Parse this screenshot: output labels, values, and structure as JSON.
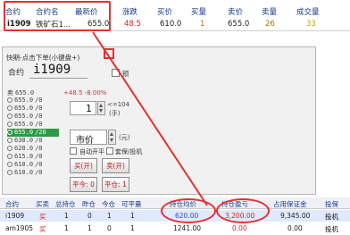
{
  "quote_table": {
    "headers": [
      "合约",
      "合约名",
      "最新价",
      "涨跌",
      "买价",
      "买量",
      "卖价",
      "卖量",
      "成交量"
    ],
    "row": {
      "code": "i1909",
      "name": "铁矿石1...",
      "last": "655.0",
      "change": "48.5",
      "bid": "610.0",
      "bid_vol": "1",
      "ask": "655.0",
      "ask_vol": "26",
      "volume": "33"
    }
  },
  "order_panel": {
    "title": "快期-点击下单(小键盘+)",
    "contract_label": "合约",
    "contract_code": "i1909",
    "pin_label": "锁",
    "price_range": "+48.5 -8.00%",
    "depth": [
      {
        "label": "卖",
        "price": "655.0",
        "qty": ""
      },
      {
        "label": "",
        "price": "655.0",
        "qty": "/0"
      },
      {
        "label": "",
        "price": "655.0",
        "qty": "/0"
      },
      {
        "label": "",
        "price": "655.0",
        "qty": "/0"
      },
      {
        "label": "",
        "price": "655.0",
        "qty": "/0"
      },
      {
        "label": "",
        "price": "655.0",
        "qty": "/26"
      },
      {
        "label": "",
        "price": "630.0",
        "qty": "/0"
      },
      {
        "label": "",
        "price": "620.0",
        "qty": "/0"
      },
      {
        "label": "",
        "price": "615.0",
        "qty": "/0"
      },
      {
        "label": "",
        "price": "610.0",
        "qty": "/0"
      },
      {
        "label": "",
        "price": "610.0",
        "qty": "/0"
      }
    ],
    "highlight_index": 5,
    "quantity": "1",
    "quantity_max": "<=104",
    "quantity_unit": "(手)",
    "price": "市价",
    "price_unit": "(元)",
    "auto_open_close_label": "自动开平",
    "hedge_label": "套保/投机",
    "buy_label": "买(开)",
    "sell_label": "卖(开)",
    "close_today_label": "平今: 0",
    "close_label": "平仓: 1"
  },
  "positions": {
    "headers": [
      "合约",
      "买卖",
      "总持仓",
      "昨仓",
      "今仓",
      "可平量",
      "持仓均价",
      "持仓盈亏",
      "占用保证金",
      "投保"
    ],
    "rows": [
      {
        "contract": "i1909",
        "side": "买",
        "total": "1",
        "yday": "0",
        "today": "1",
        "avail": "1",
        "avg": "620.00",
        "pnl": "3,200.00",
        "margin": "9,345.00",
        "hedge": "投机"
      },
      {
        "contract": "am1905",
        "side": "买",
        "total": "1",
        "yday": "1",
        "today": "0",
        "avail": "1",
        "avg": "1241.00",
        "pnl": "0.00",
        "margin": "0.00",
        "hedge": "投机"
      }
    ]
  },
  "colors": {
    "annotation": "#e53030",
    "highlight_row": "#2f9a45",
    "header_text": "#1a3a8a",
    "up_red": "#e02020"
  }
}
